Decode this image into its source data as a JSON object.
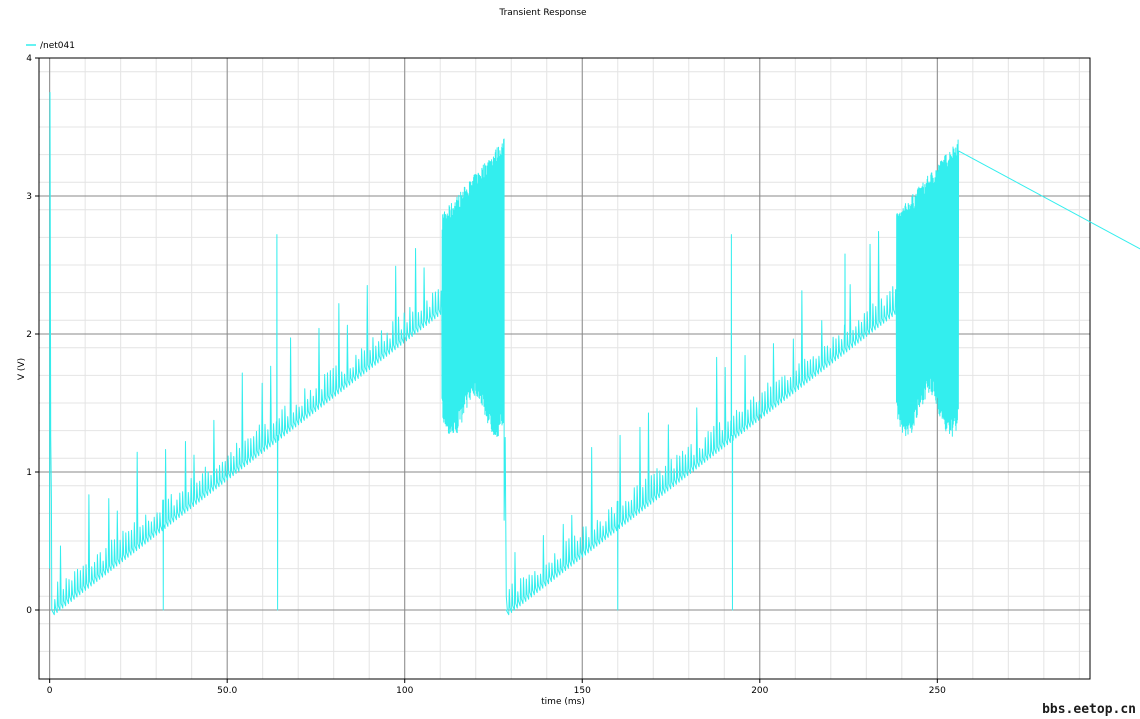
{
  "chart_data": {
    "type": "line",
    "title": "Transient Response",
    "xlabel": "time (ms)",
    "ylabel": "V (V)",
    "xlim": [
      -3,
      293
    ],
    "ylim": [
      -0.5,
      4
    ],
    "x_ticks": [
      0,
      50,
      100,
      150,
      200,
      250
    ],
    "x_tick_labels": [
      "0",
      "50.0",
      "100",
      "150",
      "200",
      "250"
    ],
    "x_minor_step": 10,
    "y_ticks": [
      0,
      1,
      2,
      3,
      4
    ],
    "y_tick_labels": [
      "0",
      "1",
      "2",
      "3",
      "4"
    ],
    "y_minor_step": 0.2,
    "grid": true,
    "legend_position": "top-left",
    "series": [
      {
        "name": "/net041",
        "color": "#33eeee",
        "period": 128,
        "ramp_start": [
          0.5,
          0.0
        ],
        "ramp_end": [
          110.5,
          2.2
        ],
        "burst_interval": [
          110.5,
          128
        ],
        "burst_low": 1.5,
        "burst_high": 3.3,
        "initial_spike": 3.75,
        "spikes": [
          [
            64,
            2.72
          ],
          [
            224,
            2.58
          ],
          [
            192,
            2.72
          ]
        ],
        "dips_to_zero": [
          [
            32,
            0.0
          ],
          [
            64.2,
            0.0
          ],
          [
            160,
            0.0
          ],
          [
            192.3,
            0.0
          ]
        ],
        "points": [
          [
            0.0,
            0.3
          ],
          [
            0.2,
            3.75
          ],
          [
            0.4,
            1.25
          ],
          [
            0.6,
            0.0
          ],
          [
            3,
            0.07
          ],
          [
            10,
            0.2
          ],
          [
            20,
            0.42
          ],
          [
            32,
            0.64
          ],
          [
            40,
            0.8
          ],
          [
            50,
            0.99
          ],
          [
            64,
            1.27
          ],
          [
            70,
            1.39
          ],
          [
            80,
            1.59
          ],
          [
            90,
            1.79
          ],
          [
            96,
            1.9
          ],
          [
            100,
            1.99
          ],
          [
            110,
            2.19
          ],
          [
            111,
            1.5
          ],
          [
            111,
            2.8
          ],
          [
            120,
            1.4
          ],
          [
            120,
            3.3
          ],
          [
            127,
            1.55
          ],
          [
            127,
            3.35
          ],
          [
            128,
            0.65
          ],
          [
            128.5,
            1.25
          ],
          [
            129,
            0.0
          ],
          [
            131,
            0.02
          ],
          [
            140,
            0.2
          ],
          [
            150,
            0.41
          ],
          [
            160,
            0.62
          ],
          [
            170,
            0.82
          ],
          [
            180,
            1.02
          ],
          [
            192,
            1.26
          ],
          [
            200,
            1.42
          ],
          [
            210,
            1.62
          ],
          [
            220,
            1.82
          ],
          [
            224,
            1.9
          ],
          [
            230,
            2.02
          ],
          [
            238,
            2.19
          ],
          [
            239,
            1.5
          ],
          [
            239,
            2.85
          ],
          [
            248,
            1.4
          ],
          [
            248,
            3.3
          ],
          [
            255,
            1.55
          ],
          [
            255,
            3.35
          ]
        ]
      }
    ]
  },
  "watermark": "bbs.eetop.cn"
}
